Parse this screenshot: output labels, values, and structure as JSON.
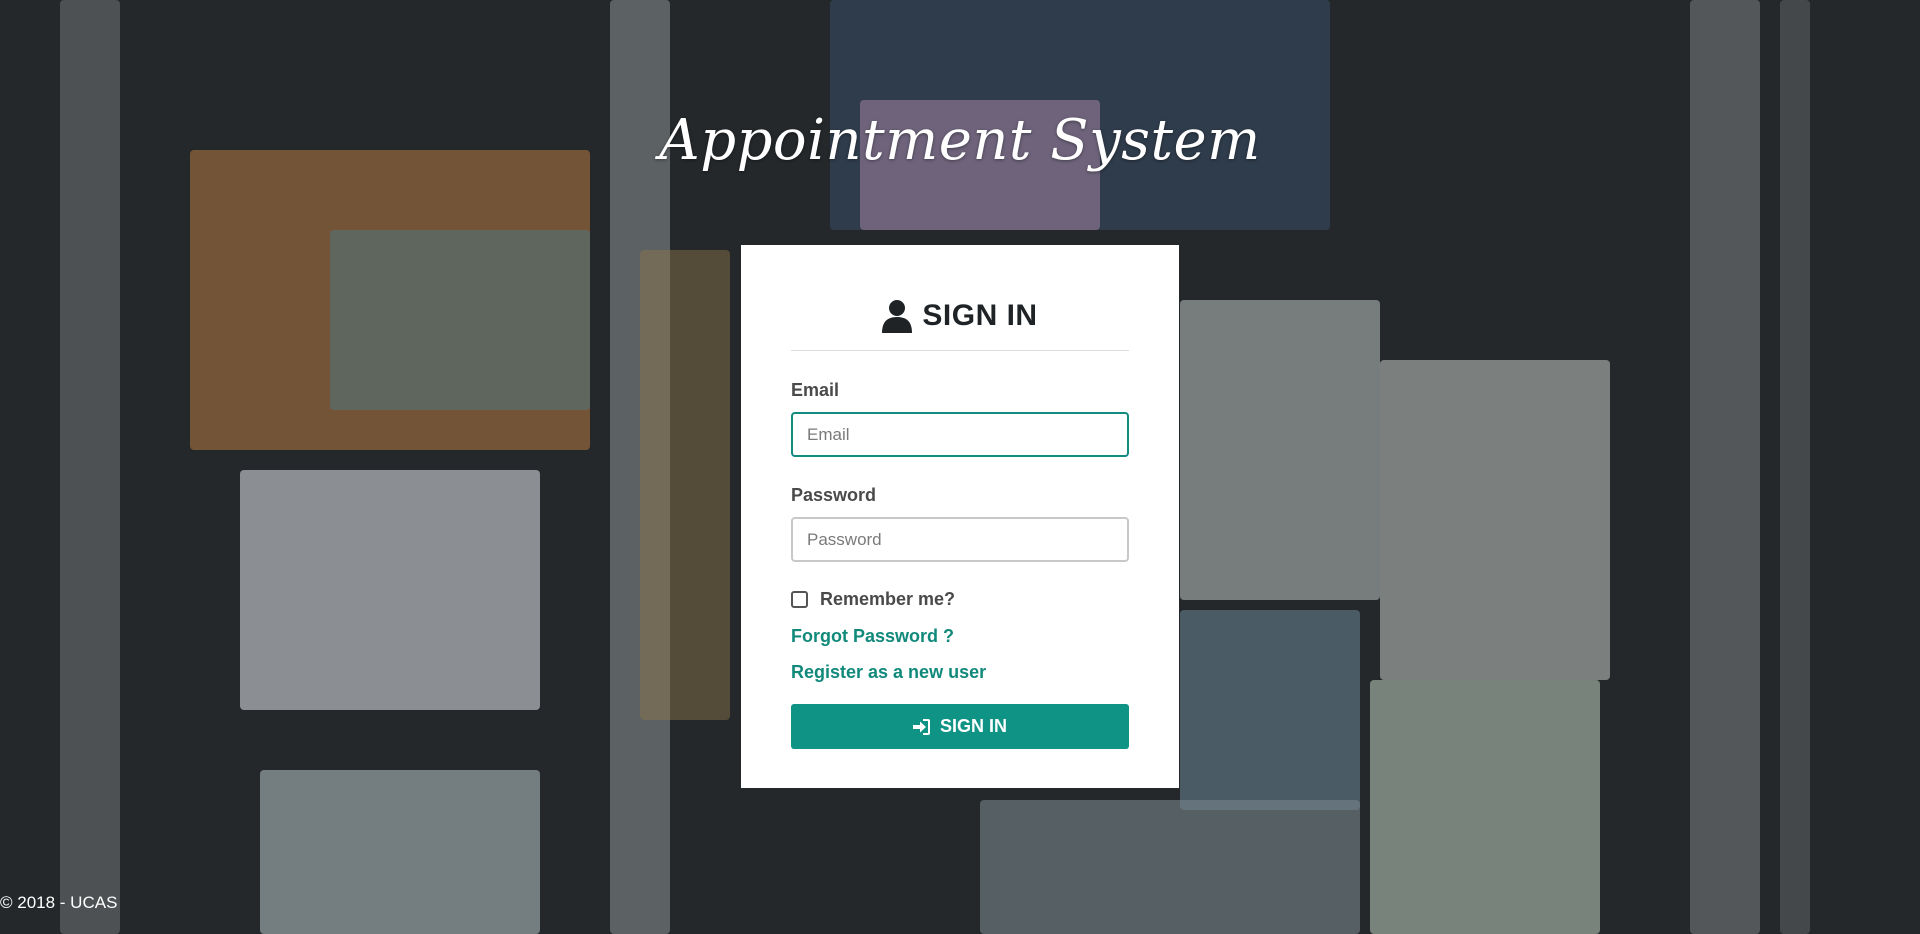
{
  "app": {
    "title": "Appointment System"
  },
  "signin_card": {
    "heading": "SIGN IN",
    "heading_icon": "user-icon",
    "email": {
      "label": "Email",
      "placeholder": "Email",
      "value": ""
    },
    "password": {
      "label": "Password",
      "placeholder": "Password",
      "value": ""
    },
    "remember_label": "Remember me?",
    "remember_checked": false,
    "forgot_link": "Forgot Password ?",
    "register_link": "Register as a new user",
    "submit_label": "SIGN IN",
    "submit_icon": "sign-in-icon"
  },
  "footer": {
    "text": "© 2018 - UCAS"
  },
  "colors": {
    "accent": "#0f9384",
    "link": "#11897b",
    "card_bg": "#ffffff"
  }
}
